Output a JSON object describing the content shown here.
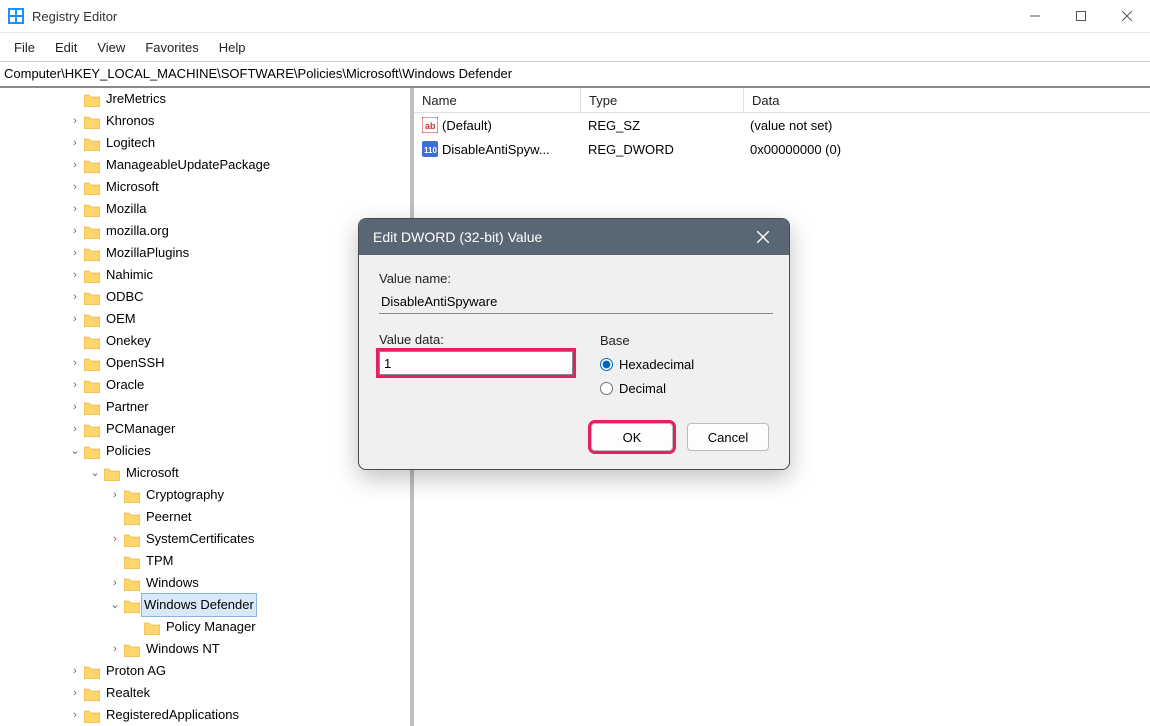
{
  "window": {
    "title": "Registry Editor"
  },
  "menu": {
    "file": "File",
    "edit": "Edit",
    "view": "View",
    "favorites": "Favorites",
    "help": "Help"
  },
  "address": "Computer\\HKEY_LOCAL_MACHINE\\SOFTWARE\\Policies\\Microsoft\\Windows Defender",
  "tree": [
    {
      "indent": 68,
      "exp": "blank",
      "label": "JreMetrics"
    },
    {
      "indent": 68,
      "exp": ">",
      "label": "Khronos"
    },
    {
      "indent": 68,
      "exp": ">",
      "label": "Logitech"
    },
    {
      "indent": 68,
      "exp": ">",
      "label": "ManageableUpdatePackage"
    },
    {
      "indent": 68,
      "exp": ">",
      "label": "Microsoft"
    },
    {
      "indent": 68,
      "exp": ">",
      "label": "Mozilla"
    },
    {
      "indent": 68,
      "exp": ">",
      "label": "mozilla.org"
    },
    {
      "indent": 68,
      "exp": ">",
      "label": "MozillaPlugins"
    },
    {
      "indent": 68,
      "exp": ">",
      "label": "Nahimic"
    },
    {
      "indent": 68,
      "exp": ">",
      "label": "ODBC"
    },
    {
      "indent": 68,
      "exp": ">",
      "label": "OEM"
    },
    {
      "indent": 68,
      "exp": "blank",
      "label": "Onekey"
    },
    {
      "indent": 68,
      "exp": ">",
      "label": "OpenSSH"
    },
    {
      "indent": 68,
      "exp": ">",
      "label": "Oracle"
    },
    {
      "indent": 68,
      "exp": ">",
      "label": "Partner"
    },
    {
      "indent": 68,
      "exp": ">",
      "label": "PCManager"
    },
    {
      "indent": 68,
      "exp": "v",
      "label": "Policies"
    },
    {
      "indent": 88,
      "exp": "v",
      "label": "Microsoft"
    },
    {
      "indent": 108,
      "exp": ">",
      "label": "Cryptography"
    },
    {
      "indent": 108,
      "exp": "blank",
      "label": "Peernet"
    },
    {
      "indent": 108,
      "exp": ">",
      "label": "SystemCertificates"
    },
    {
      "indent": 108,
      "exp": "blank",
      "label": "TPM"
    },
    {
      "indent": 108,
      "exp": ">",
      "label": "Windows"
    },
    {
      "indent": 108,
      "exp": "v",
      "label": "Windows Defender",
      "selected": true
    },
    {
      "indent": 128,
      "exp": "blank",
      "label": "Policy Manager"
    },
    {
      "indent": 108,
      "exp": ">",
      "label": "Windows NT"
    },
    {
      "indent": 68,
      "exp": ">",
      "label": "Proton AG"
    },
    {
      "indent": 68,
      "exp": ">",
      "label": "Realtek"
    },
    {
      "indent": 68,
      "exp": ">",
      "label": "RegisteredApplications"
    }
  ],
  "columns": {
    "name": "Name",
    "type": "Type",
    "data": "Data"
  },
  "colwidths": {
    "name": 150,
    "type": 146,
    "data": 360
  },
  "values": [
    {
      "icon": "string-icon",
      "name": "(Default)",
      "type": "REG_SZ",
      "data": "(value not set)"
    },
    {
      "icon": "dword-icon",
      "name": "DisableAntiSpyw...",
      "type": "REG_DWORD",
      "data": "0x00000000 (0)"
    }
  ],
  "dialog": {
    "title": "Edit DWORD (32-bit) Value",
    "value_name_label": "Value name:",
    "value_name": "DisableAntiSpyware",
    "value_data_label": "Value data:",
    "value_data": "1",
    "base_label": "Base",
    "hex": "Hexadecimal",
    "dec": "Decimal",
    "base_selected": "hex",
    "ok": "OK",
    "cancel": "Cancel"
  }
}
